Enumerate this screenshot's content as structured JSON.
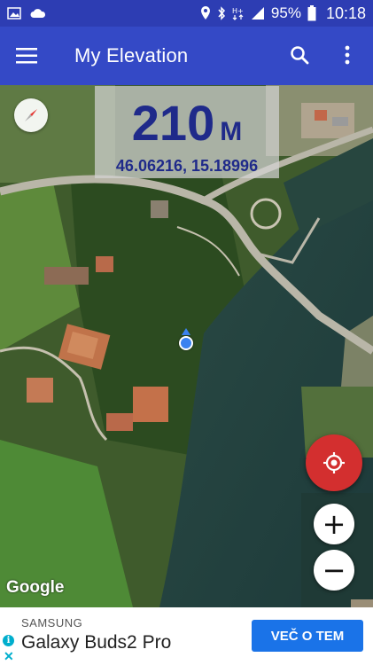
{
  "status_bar": {
    "battery": "95%",
    "time": "10:18",
    "icons_left": [
      "image-icon",
      "cloud-icon"
    ],
    "icons_right": [
      "location-icon",
      "bluetooth-icon",
      "hplus-icon",
      "signal-icon",
      "battery-icon"
    ]
  },
  "app_bar": {
    "title": "My Elevation",
    "icons": [
      "menu-icon",
      "search-icon",
      "more-vert-icon"
    ]
  },
  "elevation": {
    "value": "210",
    "unit": "M",
    "coordinates": "46.06216, 15.18996"
  },
  "map": {
    "attribution": "Google",
    "zoom_in_label": "+",
    "zoom_out_label": "−",
    "colors": {
      "locate_fab": "#d32f2f",
      "location_dot": "#3b82f0"
    }
  },
  "ad": {
    "brand": "SAMSUNG",
    "product": "Galaxy Buds2 Pro",
    "cta": "VEČ O TEM"
  },
  "colors": {
    "status_bar": "#2d3db3",
    "app_bar": "#3449c6",
    "elevation_text": "#1f2a8a",
    "ad_button": "#1a73e8"
  }
}
